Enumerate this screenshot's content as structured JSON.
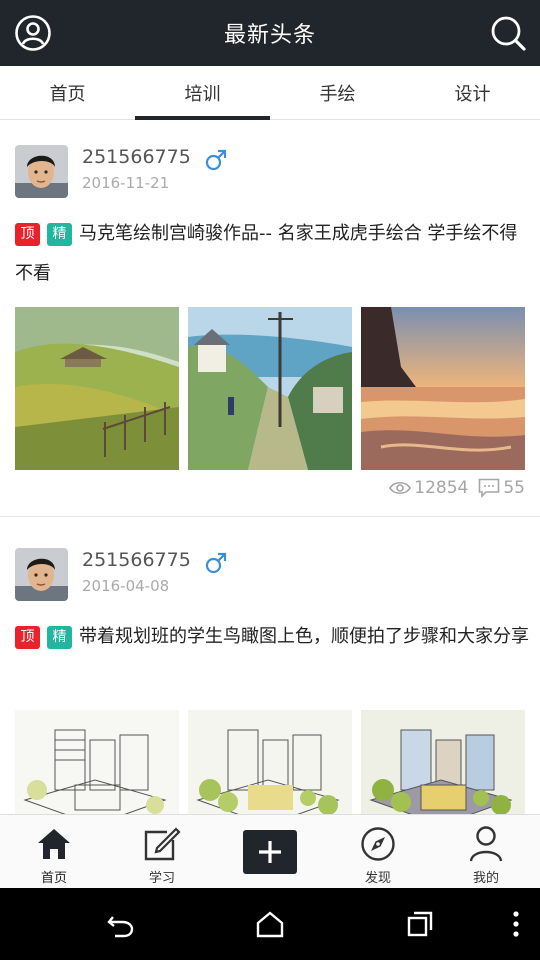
{
  "header": {
    "title": "最新头条"
  },
  "tabs": [
    {
      "label": "首页"
    },
    {
      "label": "培训",
      "active": true
    },
    {
      "label": "手绘"
    },
    {
      "label": "设计"
    }
  ],
  "posts": [
    {
      "username": "251566775",
      "gender": "male",
      "date": "2016-11-21",
      "badge_top": "顶",
      "badge_fine": "精",
      "title": "马克笔绘制宫崎骏作品-- 名家王成虎手绘合 学手绘不得不看",
      "images": [
        "countryside-field-illustration",
        "hillside-street-illustration",
        "sunset-beach-watercolor"
      ],
      "views": "12854",
      "comments": "55"
    },
    {
      "username": "251566775",
      "gender": "male",
      "date": "2016-04-08",
      "badge_top": "顶",
      "badge_fine": "精",
      "title": "带着规划班的学生鸟瞰图上色，顺便拍了步骤和大家分享",
      "images": [
        "aerial-sketch-lineart",
        "aerial-sketch-partial-color",
        "aerial-sketch-full-color"
      ]
    }
  ],
  "bottom_nav": [
    {
      "label": "首页",
      "icon": "home-icon",
      "active": true
    },
    {
      "label": "学习",
      "icon": "edit-icon"
    },
    {
      "label": "",
      "icon": "plus-icon"
    },
    {
      "label": "发现",
      "icon": "compass-icon"
    },
    {
      "label": "我的",
      "icon": "user-icon"
    }
  ],
  "colors": {
    "header_bg": "#21262c",
    "badge_top": "#e8232b",
    "badge_fine": "#22b59f",
    "gender_male": "#3a8fd6"
  }
}
